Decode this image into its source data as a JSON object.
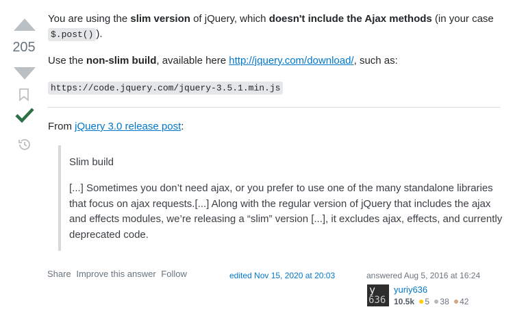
{
  "vote": {
    "count": "205"
  },
  "answer": {
    "p1": {
      "t1": "You are using the ",
      "b1": "slim version",
      "t2": " of jQuery, which ",
      "b2": "doesn't include the Ajax methods",
      "t3": " (in your case ",
      "code": "$.post()",
      "t4": ")."
    },
    "p2": {
      "t1": "Use the ",
      "b1": "non-slim build",
      "t2": ", available here ",
      "link": "http://jquery.com/download/",
      "t3": ", such as:"
    },
    "code_block": "https://code.jquery.com/jquery-3.5.1.min.js",
    "p3": {
      "t1": "From ",
      "link": "jQuery 3.0 release post",
      "t2": ":"
    },
    "quote": {
      "title": "Slim build",
      "body": "[...] Sometimes you don’t need ajax, or you prefer to use one of the many standalone libraries that focus on ajax requests.[...] Along with the regular version of jQuery that includes the ajax and effects modules, we’re releasing a “slim” version [...], it excludes ajax, effects, and currently deprecated code."
    }
  },
  "actions": {
    "share": "Share",
    "improve": "Improve this answer",
    "follow": "Follow"
  },
  "edited": "edited Nov 15, 2020 at 20:03",
  "answered": "answered Aug 5, 2016 at 16:24",
  "user": {
    "name": "yuriy636",
    "avatar_line1": "y",
    "avatar_line2": "636",
    "reputation": "10.5k",
    "gold": "5",
    "silver": "38",
    "bronze": "42"
  },
  "colors": {
    "gold": "#ffcc01",
    "silver": "#b4b8bc",
    "bronze": "#d1a684",
    "accepted": "#2f6f44",
    "link": "#0077cc"
  }
}
